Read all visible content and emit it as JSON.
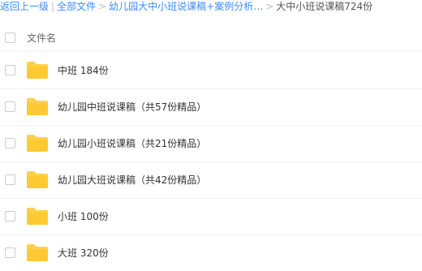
{
  "breadcrumb": {
    "back": "返回上一级",
    "all_files": "全部文件",
    "parent": "幼儿园大中小班说课稿+案例分析…",
    "current": "大中小班说课稿724份",
    "link_color": "#3b8cff"
  },
  "list_header": {
    "column": "文件名"
  },
  "folder_icon_color": "#ffd04b",
  "files": [
    {
      "name": "中班 184份"
    },
    {
      "name": "幼儿园中班说课稿（共57份精品）"
    },
    {
      "name": "幼儿园小班说课稿（共21份精品）"
    },
    {
      "name": "幼儿园大班说课稿（共42份精品）"
    },
    {
      "name": "小班 100份"
    },
    {
      "name": "大班 320份"
    }
  ]
}
